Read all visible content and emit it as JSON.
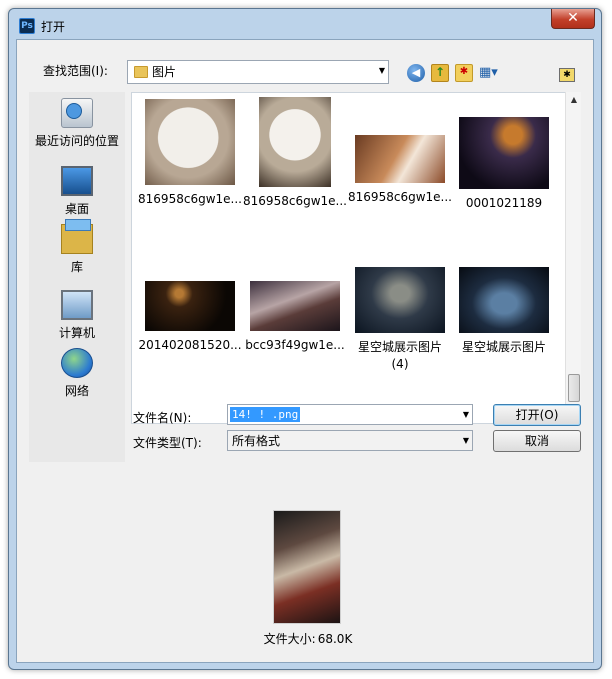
{
  "window": {
    "title": "打开",
    "app_icon": "Ps",
    "close_glyph": "✕"
  },
  "toolbar": {
    "look_in_label": "查找范围(I):",
    "look_in_value": "图片",
    "icons": [
      "back-icon",
      "up-folder-icon",
      "new-folder-icon",
      "view-menu-icon",
      "star-icon"
    ]
  },
  "places": [
    {
      "label": "最近访问的位置",
      "icon": "recent-places-icon"
    },
    {
      "label": "桌面",
      "icon": "desktop-icon"
    },
    {
      "label": "库",
      "icon": "library-icon"
    },
    {
      "label": "计算机",
      "icon": "computer-icon"
    },
    {
      "label": "网络",
      "icon": "network-icon"
    }
  ],
  "files": [
    {
      "name": "816958c6gw1e..."
    },
    {
      "name": "816958c6gw1e..."
    },
    {
      "name": "816958c6gw1e..."
    },
    {
      "name": "0001021189"
    },
    {
      "name": "201402081520..."
    },
    {
      "name": "bcc93f49gw1e..."
    },
    {
      "name": "星空城展示图片",
      "name2": "(4)"
    },
    {
      "name": "星空城展示图片"
    }
  ],
  "form": {
    "filename_label": "文件名(N):",
    "filename_value": "14! ! .png",
    "filetype_label": "文件类型(T):",
    "filetype_value": "所有格式",
    "open_button": "打开(O)",
    "cancel_button": "取消"
  },
  "preview": {
    "size_label": "文件大小:",
    "size_value": "68.0K"
  }
}
